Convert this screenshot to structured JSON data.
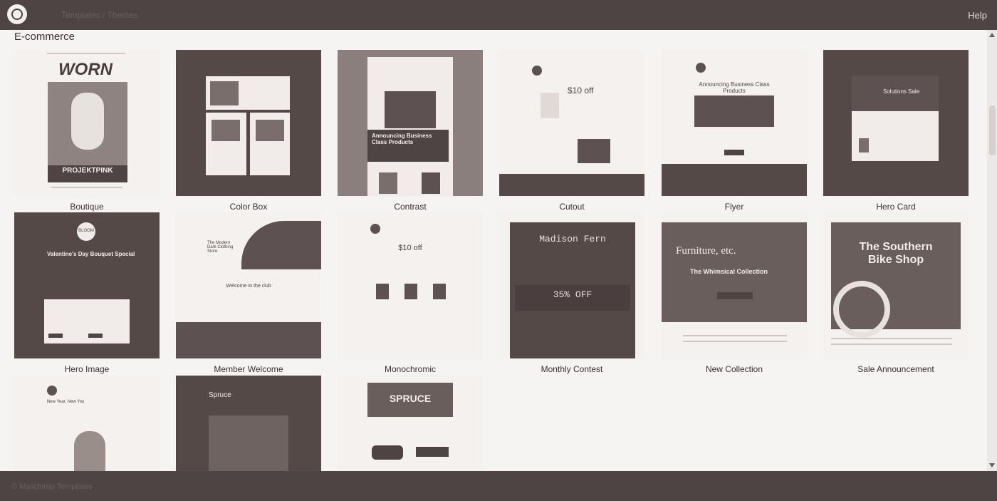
{
  "header": {
    "help_label": "Help",
    "breadcrumb": "Templates / Themes"
  },
  "category": "E-commerce",
  "templates": [
    {
      "label": "Boutique"
    },
    {
      "label": "Color Box"
    },
    {
      "label": "Contrast"
    },
    {
      "label": "Cutout"
    },
    {
      "label": "Flyer"
    },
    {
      "label": "Hero Card"
    },
    {
      "label": "Hero Image"
    },
    {
      "label": "Member Welcome"
    },
    {
      "label": "Monochromic"
    },
    {
      "label": "Monthly Contest"
    },
    {
      "label": "New Collection"
    },
    {
      "label": "Sale Announcement"
    }
  ],
  "thumb_text": {
    "boutique_logo": "WORN",
    "boutique_brand": "PROJEKTPINK",
    "contrast_title": "Announcing Business Class Products",
    "cutout_offer": "$10 off",
    "flyer_title": "Announcing Business Class Products",
    "hero_card_title": "Solutions Sale",
    "hero_image_title": "Valentine's Day Bouquet Special",
    "hero_image_badge": "BLOOM",
    "member_welcome_title": "The Modern Dark Clothing Store",
    "member_welcome_msg": "Welcome to the club",
    "mono_offer": "$10 off",
    "monthly_contest_title": "Madison Fern",
    "monthly_contest_offer": "35% OFF",
    "new_collection_title": "Furniture, etc.",
    "new_collection_sub": "The Whimsical Collection",
    "sale_title_1": "The Southern",
    "sale_title_2": "Bike Shop",
    "row3_spruce": "Spruce",
    "row3_spruce_banner": "SPRUCE",
    "row3_new_you": "New Year, New You"
  },
  "footer": {
    "text": "© Mailchimp Templates"
  },
  "colors": {
    "dark": "#4f4444",
    "background": "#f6f4f2"
  }
}
